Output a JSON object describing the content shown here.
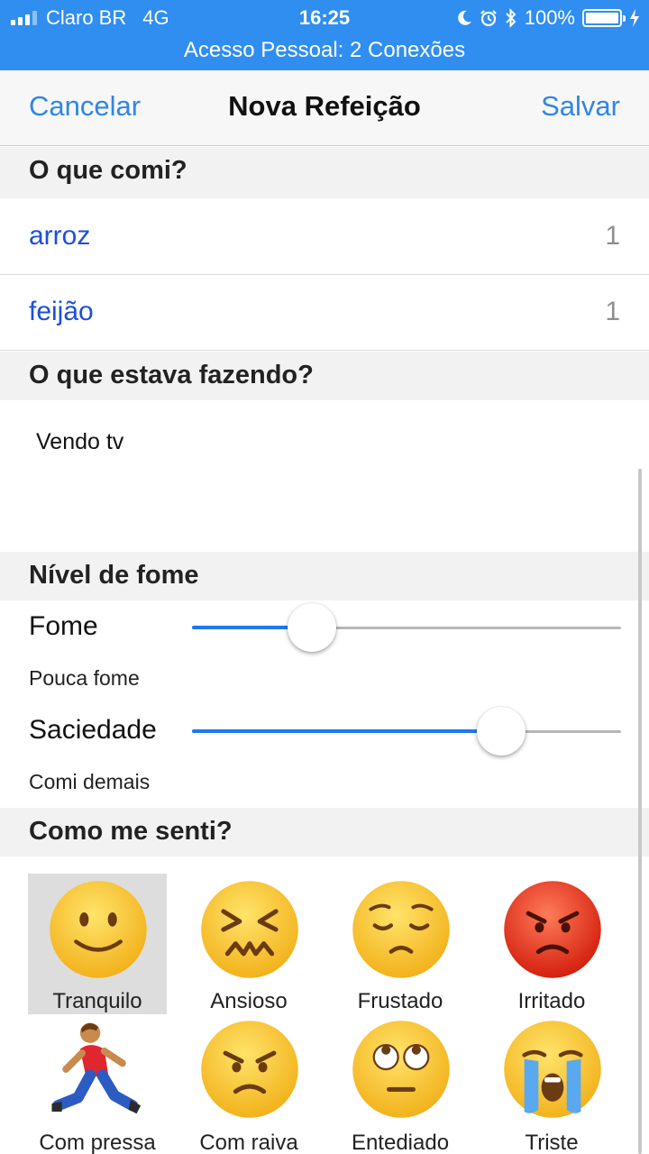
{
  "status_bar": {
    "carrier": "Claro BR",
    "network": "4G",
    "time": "16:25",
    "battery": "100%",
    "hotspot": "Acesso Pessoal: 2 Conexões",
    "color": "#2f8ef0"
  },
  "nav": {
    "cancel": "Cancelar",
    "title": "Nova Refeição",
    "save": "Salvar",
    "accent": "#2f86e6"
  },
  "sections": {
    "food": "O que comi?",
    "activity": "O que estava fazendo?",
    "hunger": "Nível de fome",
    "feeling": "Como me senti?"
  },
  "foods": [
    {
      "name": "arroz",
      "qty": "1"
    },
    {
      "name": "feijão",
      "qty": "1"
    }
  ],
  "activity_text": "Vendo tv",
  "sliders": [
    {
      "label": "Fome",
      "description": "Pouca fome",
      "value": 0.28
    },
    {
      "label": "Saciedade",
      "description": "Comi demais",
      "value": 0.72
    }
  ],
  "moods": [
    {
      "label": "Tranquilo",
      "icon": "slightly-smiling-face-icon",
      "selected": true
    },
    {
      "label": "Ansioso",
      "icon": "confounded-face-icon",
      "selected": false
    },
    {
      "label": "Frustado",
      "icon": "pensive-face-icon",
      "selected": false
    },
    {
      "label": "Irritado",
      "icon": "pouting-face-icon",
      "selected": false
    },
    {
      "label": "Com pressa",
      "icon": "running-man-icon",
      "selected": false
    },
    {
      "label": "Com raiva",
      "icon": "angry-face-icon",
      "selected": false
    },
    {
      "label": "Entediado",
      "icon": "face-with-rolling-eyes-icon",
      "selected": false
    },
    {
      "label": "Triste",
      "icon": "loudly-crying-face-icon",
      "selected": false
    }
  ]
}
